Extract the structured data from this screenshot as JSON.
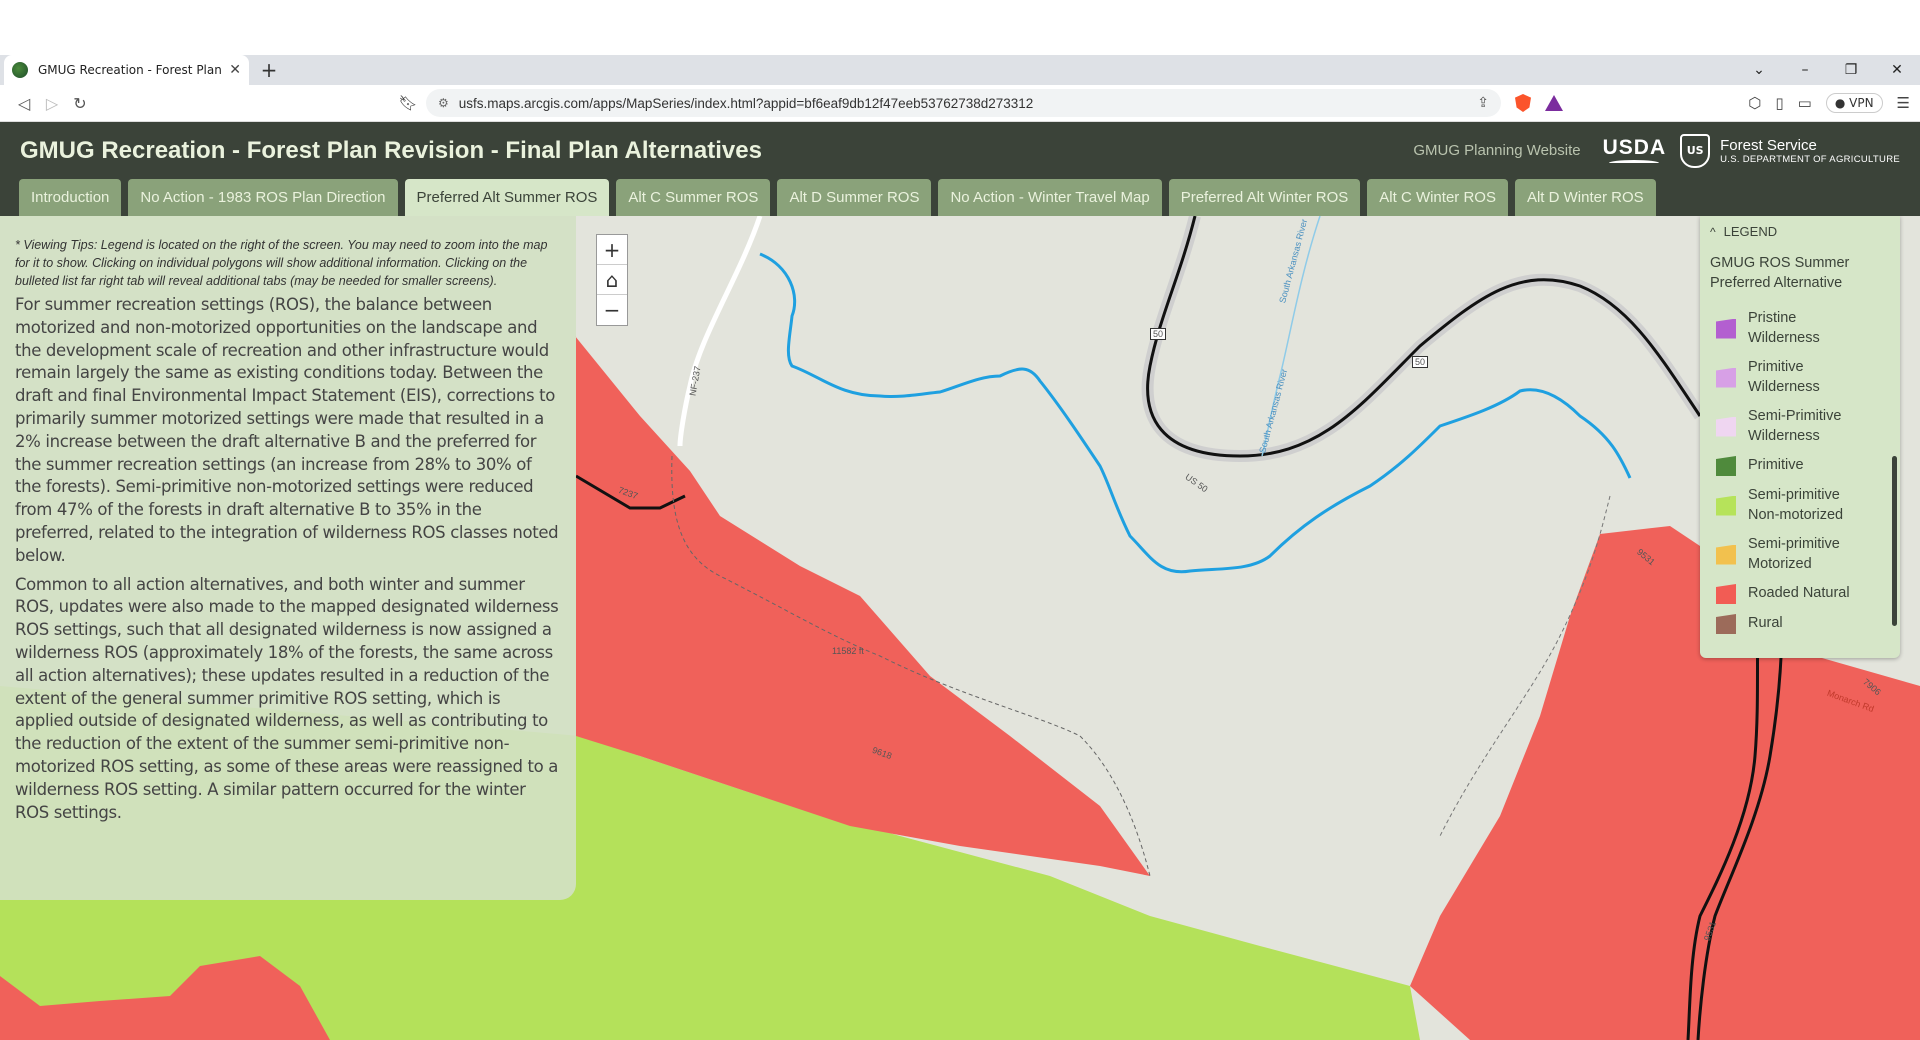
{
  "browser": {
    "tab_title": "GMUG Recreation - Forest Plan R",
    "tab_close": "✕",
    "new_tab": "+",
    "url": "usfs.maps.arcgis.com/apps/MapSeries/index.html?appid=bf6eaf9db12f47eeb53762738d273312",
    "vpn_label": "VPN",
    "controls": {
      "dropdown": "⌄",
      "minimize": "–",
      "restore": "❐",
      "close": "✕"
    }
  },
  "app": {
    "title": "GMUG Recreation - Forest Plan Revision - Final Plan Alternatives",
    "planning_link": "GMUG Planning Website",
    "usda": "USDA",
    "forest_service": "Forest Service",
    "forest_service_sub": "U.S. DEPARTMENT OF AGRICULTURE"
  },
  "tabs": [
    {
      "label": "Introduction"
    },
    {
      "label": "No Action - 1983 ROS Plan Direction"
    },
    {
      "label": "Preferred Alt Summer ROS"
    },
    {
      "label": "Alt C Summer ROS"
    },
    {
      "label": "Alt D Summer ROS"
    },
    {
      "label": "No Action - Winter Travel Map"
    },
    {
      "label": "Preferred Alt Winter ROS"
    },
    {
      "label": "Alt C Winter ROS"
    },
    {
      "label": "Alt D Winter ROS"
    }
  ],
  "active_tab": "Preferred Alt Summer ROS",
  "panel": {
    "tips": "* Viewing Tips: Legend is located on the right of the screen. You may need to zoom into the map for it to show. Clicking on individual polygons will show additional information. Clicking on the bulleted list far right tab will reveal additional tabs (may be needed for smaller screens).",
    "para1": "For summer recreation settings (ROS), the balance between motorized and non-motorized opportunities on the landscape and the development scale of recreation and other infrastructure would remain largely the same as existing conditions today. Between the draft and final Environmental Impact Statement (EIS), corrections to primarily summer motorized settings were made that resulted in a 2% increase between the draft alternative B and the preferred for the summer recreation settings (an increase from 28% to 30% of the forests). Semi-primitive non-motorized settings were reduced from 47% of the forests in draft alternative B to 35% in the preferred, related to the integration of wilderness ROS classes noted below.",
    "para2": "Common to all action alternatives, and both winter and summer ROS, updates were also made to the mapped designated wilderness ROS settings, such that all designated wilderness is now assigned a wilderness ROS (approximately 18% of the forests, the same across all action alternatives); these updates resulted in a reduction of the extent of the general summer primitive ROS setting, which is applied outside of designated wilderness, as well as contributing to the reduction of the extent of the summer semi-primitive non-motorized ROS setting, as some of these areas were reassigned to a wilderness ROS setting. A similar pattern occurred for the winter ROS settings."
  },
  "zoom": {
    "in": "+",
    "home": "⌂",
    "out": "−"
  },
  "legend": {
    "header": "LEGEND",
    "layer_title": "GMUG ROS Summer Preferred Alternative",
    "items": [
      {
        "label": "Pristine Wilderness",
        "color": "#b35fd0"
      },
      {
        "label": "Primitive Wilderness",
        "color": "#d7a0e6"
      },
      {
        "label": "Semi-Primitive Wilderness",
        "color": "#efd6f1"
      },
      {
        "label": "Primitive",
        "color": "#4f8a3c"
      },
      {
        "label": "Semi-primitive Non-motorized",
        "color": "#b6e35a"
      },
      {
        "label": "Semi-primitive Motorized",
        "color": "#f2c14e"
      },
      {
        "label": "Roaded Natural",
        "color": "#f25c54"
      },
      {
        "label": "Rural",
        "color": "#9c6b5a"
      }
    ]
  },
  "map_labels": {
    "nf237": "NF-237",
    "r7237": "7237",
    "elev": "11582 ft",
    "t9618": "9618",
    "us50a": "50",
    "us50b": "US 50",
    "us50c": "50",
    "river1": "South Arkansas River",
    "river2": "South Arkansas River",
    "t9531": "9531",
    "t7906": "7906",
    "monarch": "Monarch Rd",
    "t9531b": "9531"
  }
}
